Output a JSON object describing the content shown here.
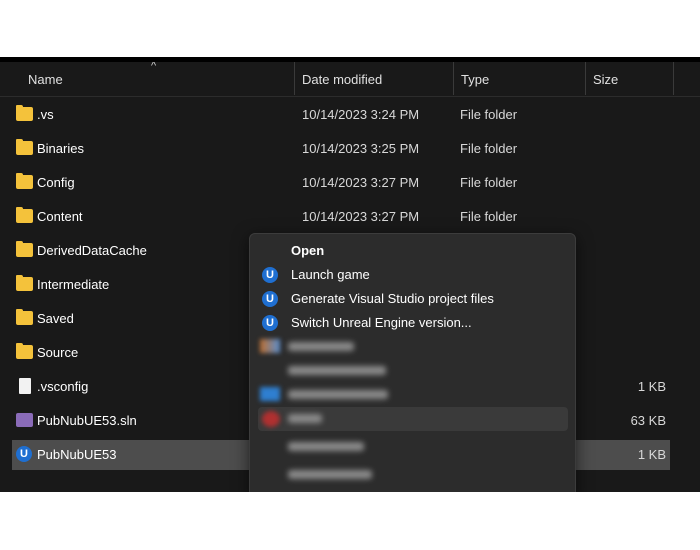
{
  "columns": {
    "name": "Name",
    "date": "Date modified",
    "type": "Type",
    "size": "Size",
    "sort_indicator": "^"
  },
  "files": [
    {
      "name": ".vs",
      "date": "10/14/2023 3:24 PM",
      "type": "File folder",
      "size": "",
      "icon": "folder-icon"
    },
    {
      "name": "Binaries",
      "date": "10/14/2023 3:25 PM",
      "type": "File folder",
      "size": "",
      "icon": "folder-icon"
    },
    {
      "name": "Config",
      "date": "10/14/2023 3:27 PM",
      "type": "File folder",
      "size": "",
      "icon": "folder-icon"
    },
    {
      "name": "Content",
      "date": "10/14/2023 3:27 PM",
      "type": "File folder",
      "size": "",
      "icon": "folder-icon"
    },
    {
      "name": "DerivedDataCache",
      "date": "",
      "type": "",
      "size": "",
      "icon": "folder-icon"
    },
    {
      "name": "Intermediate",
      "date": "",
      "type": "",
      "size": "",
      "icon": "folder-icon"
    },
    {
      "name": "Saved",
      "date": "",
      "type": "",
      "size": "",
      "icon": "folder-icon"
    },
    {
      "name": "Source",
      "date": "",
      "type": "",
      "size": "",
      "icon": "folder-icon"
    },
    {
      "name": ".vsconfig",
      "date": "",
      "type": "",
      "size": "1 KB",
      "icon": "document-icon"
    },
    {
      "name": "PubNubUE53.sln",
      "date": "",
      "type": "",
      "size": "63 KB",
      "icon": "visual-studio-solution-icon"
    },
    {
      "name": "PubNubUE53",
      "date": "",
      "type": ".",
      "size": "1 KB",
      "icon": "unreal-engine-icon",
      "selected": true
    }
  ],
  "context_menu": {
    "open": "Open",
    "launch_game": "Launch game",
    "generate_vs": "Generate Visual Studio project files",
    "switch_ue": "Switch Unreal Engine version...",
    "ue_glyph": "U"
  },
  "colors": {
    "background": "#191919",
    "selection": "#4d4d4d",
    "menu_background": "#2c2c2c",
    "folder": "#f4c23b",
    "unreal_blue": "#1f6fd1"
  }
}
